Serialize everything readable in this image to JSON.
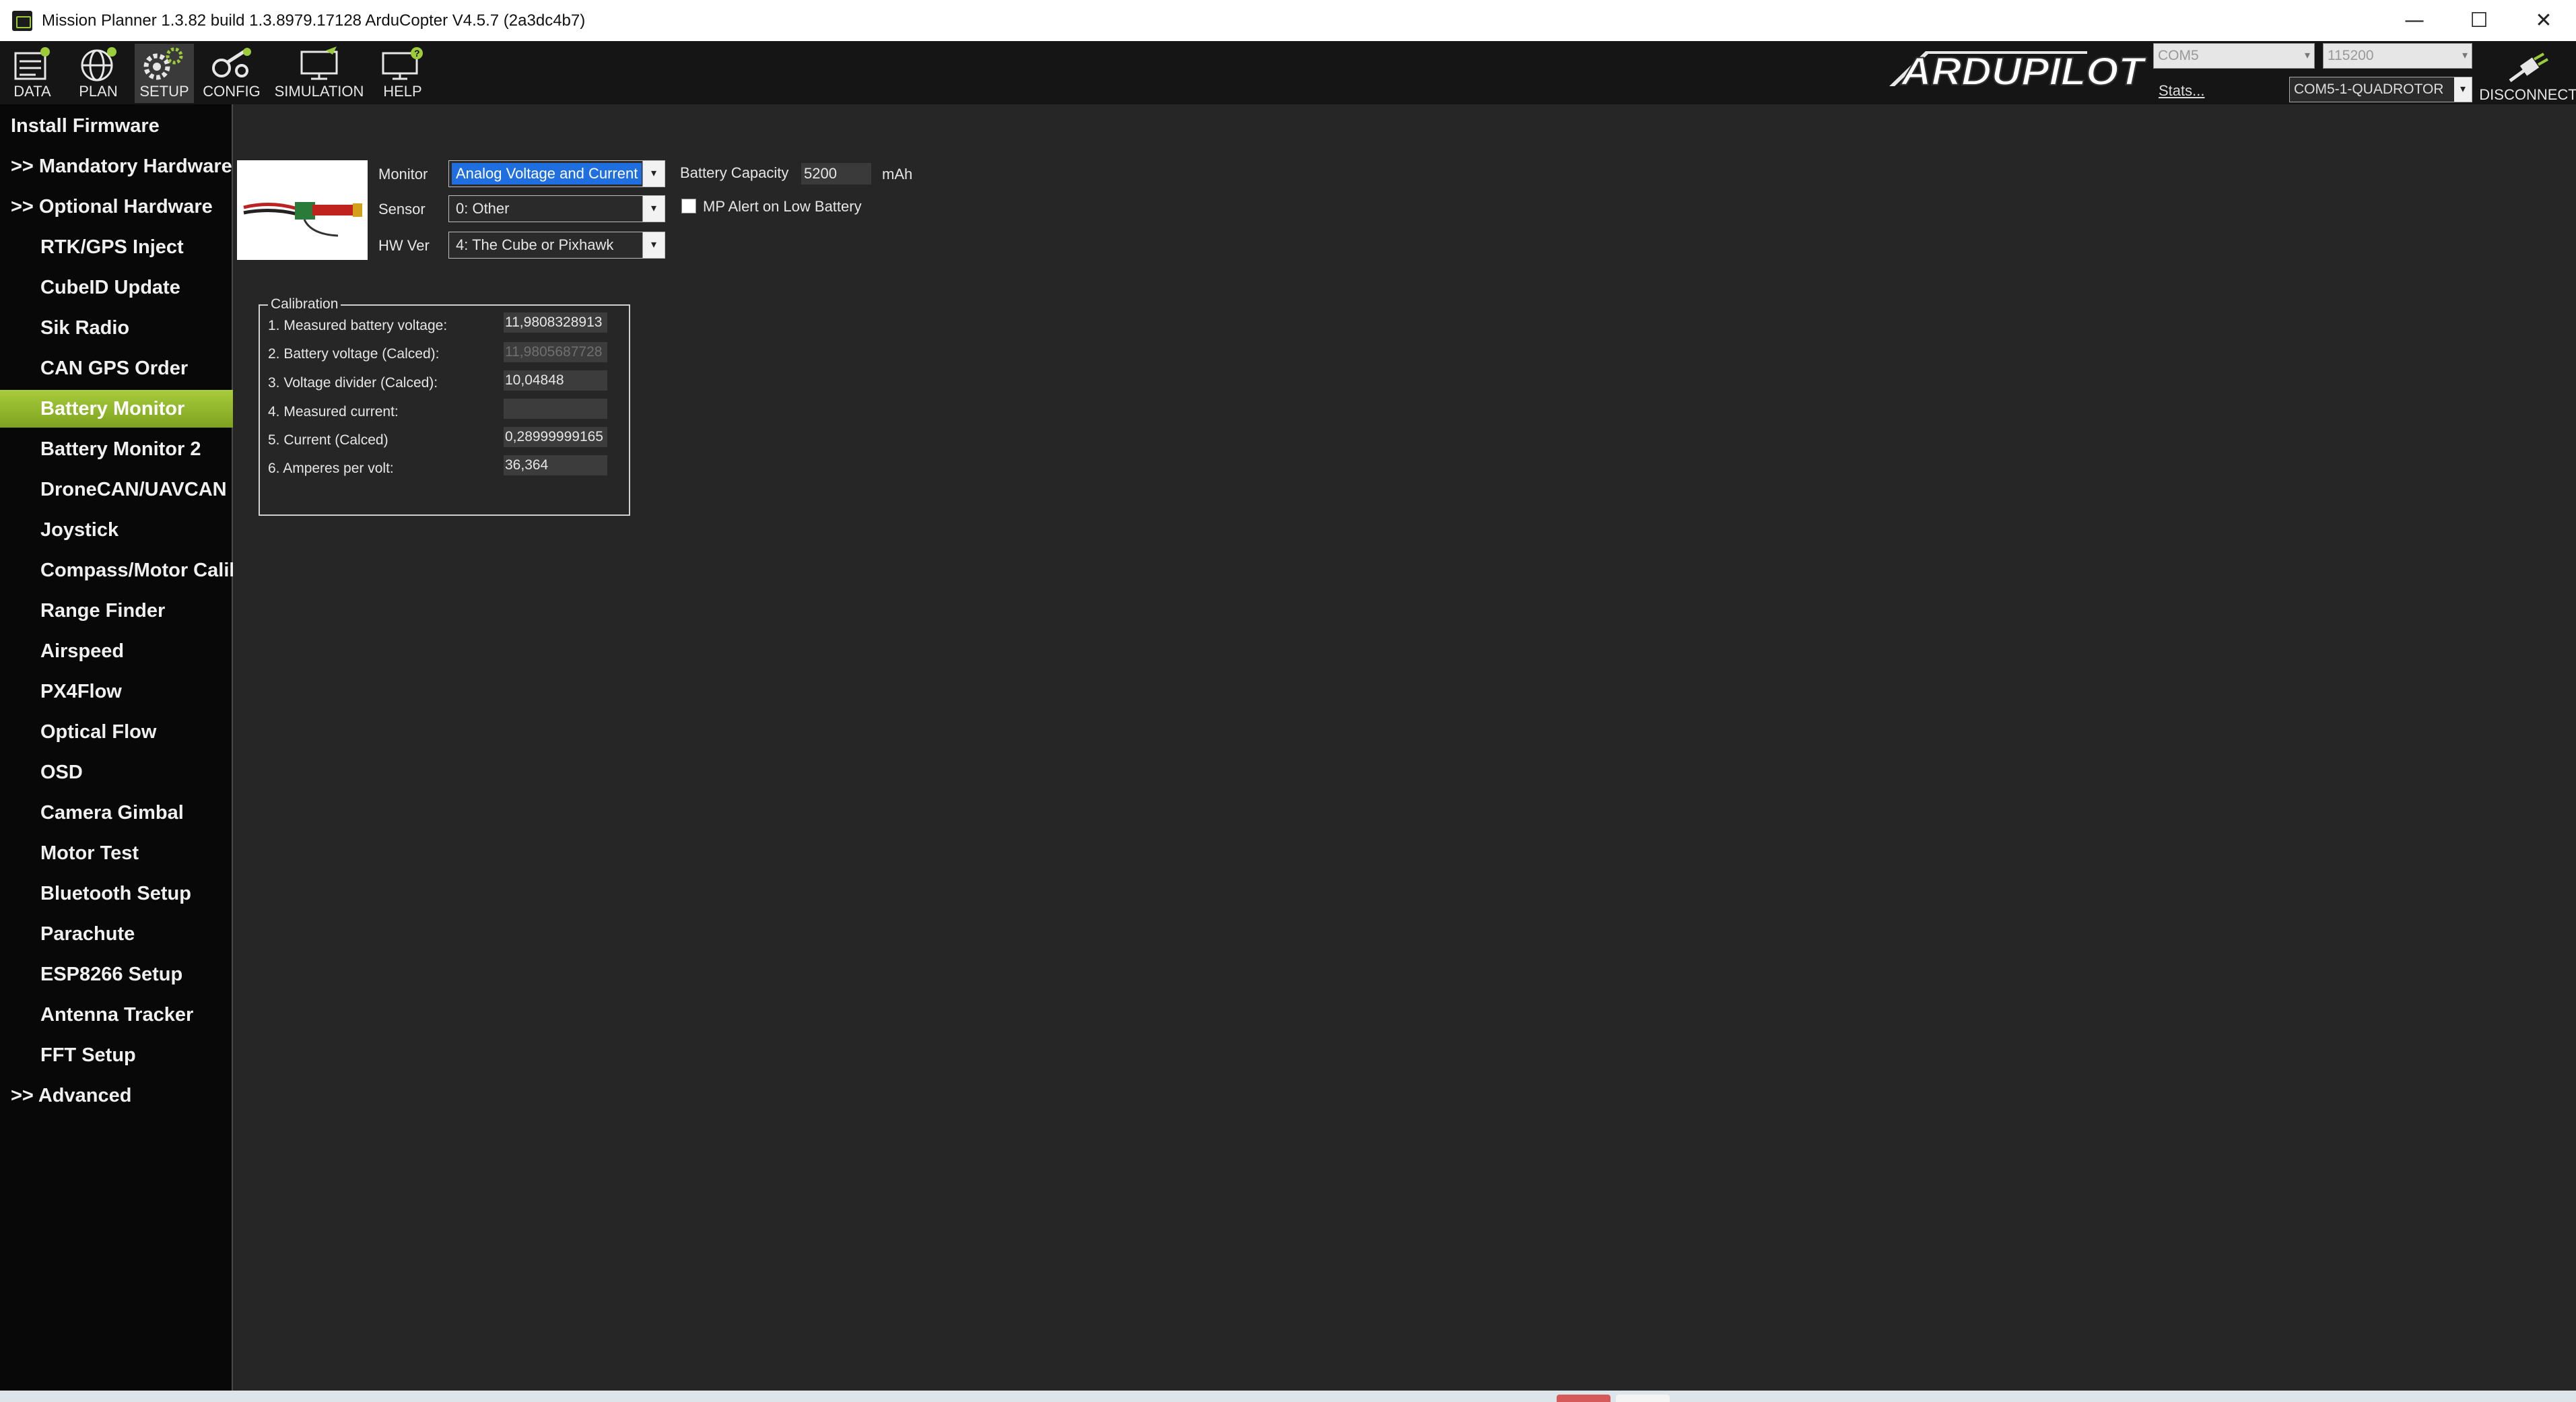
{
  "window": {
    "title": "Mission Planner 1.3.82 build 1.3.8979.17128 ArduCopter V4.5.7 (2a3dc4b7)",
    "minimize": "—",
    "maximize": "☐",
    "close": "✕"
  },
  "toolbar": {
    "data": "DATA",
    "plan": "PLAN",
    "setup": "SETUP",
    "config": "CONFIG",
    "simulation": "SIMULATION",
    "help": "HELP",
    "logo_text": "ARDUPILOT",
    "port": "COM5",
    "baud": "115200",
    "stats": "Stats...",
    "connection": "COM5-1-QUADROTOR",
    "disconnect": "DISCONNECT",
    "accent_color": "#9ccc3a"
  },
  "sidebar": {
    "items": [
      {
        "label": "Install Firmware"
      },
      {
        "label": ">> Mandatory Hardware"
      },
      {
        "label": ">> Optional Hardware"
      },
      {
        "label": "RTK/GPS Inject"
      },
      {
        "label": "CubeID Update"
      },
      {
        "label": "Sik Radio"
      },
      {
        "label": "CAN GPS Order"
      },
      {
        "label": "Battery Monitor"
      },
      {
        "label": "Battery Monitor 2"
      },
      {
        "label": "DroneCAN/UAVCAN"
      },
      {
        "label": "Joystick"
      },
      {
        "label": "Compass/Motor Calib"
      },
      {
        "label": "Range Finder"
      },
      {
        "label": "Airspeed"
      },
      {
        "label": "PX4Flow"
      },
      {
        "label": "Optical Flow"
      },
      {
        "label": "OSD"
      },
      {
        "label": "Camera Gimbal"
      },
      {
        "label": "Motor Test"
      },
      {
        "label": "Bluetooth Setup"
      },
      {
        "label": "Parachute"
      },
      {
        "label": "ESP8266 Setup"
      },
      {
        "label": "Antenna Tracker"
      },
      {
        "label": "FFT Setup"
      },
      {
        "label": ">> Advanced"
      }
    ],
    "selected_label": "Battery Monitor"
  },
  "battery": {
    "monitor_label": "Monitor",
    "monitor_value": "Analog Voltage and Current",
    "sensor_label": "Sensor",
    "sensor_value": "0: Other",
    "hwver_label": "HW Ver",
    "hwver_value": "4: The Cube or Pixhawk",
    "capacity_label": "Battery Capacity",
    "capacity_value": "5200",
    "capacity_unit": "mAh",
    "alert_label": "MP Alert on Low Battery",
    "alert_checked": false
  },
  "calibration": {
    "title": "Calibration",
    "rows": [
      {
        "label": "1. Measured battery voltage:",
        "value": "11,9808328913"
      },
      {
        "label": "2. Battery voltage (Calced):",
        "value": "11,9805687728"
      },
      {
        "label": "3. Voltage divider (Calced):",
        "value": "10,04848"
      },
      {
        "label": "4. Measured current:",
        "value": ""
      },
      {
        "label": "5. Current (Calced)",
        "value": "0,28999999165"
      },
      {
        "label": "6. Amperes per volt:",
        "value": "36,364"
      }
    ]
  }
}
